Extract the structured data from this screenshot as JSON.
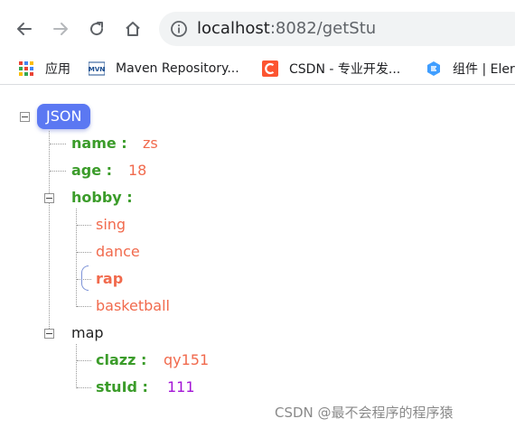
{
  "browser": {
    "url_host": "localhost",
    "url_path": ":8082/getStu"
  },
  "bookmarks": [
    {
      "label": "应用",
      "icon": "apps-grid-icon"
    },
    {
      "label": "Maven Repository...",
      "icon": "mvn-icon"
    },
    {
      "label": "CSDN - 专业开发...",
      "icon": "csdn-icon"
    },
    {
      "label": "组件 | Eler",
      "icon": "element-icon"
    }
  ],
  "tree": {
    "root_label": "JSON",
    "name": {
      "key": "name :",
      "value": "zs"
    },
    "age": {
      "key": "age :",
      "value": "18"
    },
    "hobby": {
      "key": "hobby :",
      "items": [
        "sing",
        "dance",
        "rap",
        "basketball"
      ]
    },
    "map": {
      "key": "map"
    },
    "clazz": {
      "key": "clazz :",
      "value": "qy151"
    },
    "stuId": {
      "key": "stuId :",
      "value": "111"
    }
  },
  "colors": {
    "key": "#3b9c2a",
    "string": "#f16a4d",
    "number_age": "#f16a4d",
    "number_stuId": "#a314d6",
    "root_pill": "#5b78f2"
  },
  "watermark": "CSDN @最不会程序的程序猿"
}
